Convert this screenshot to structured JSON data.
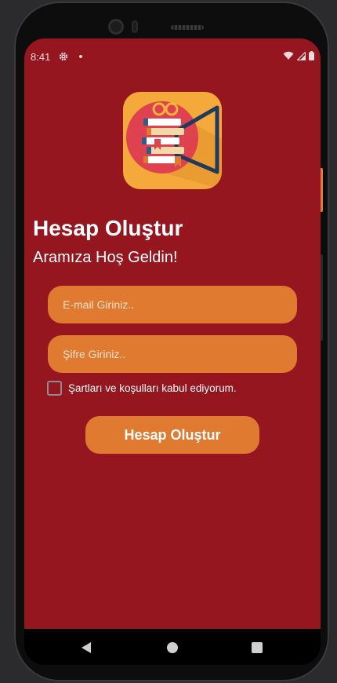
{
  "status_bar": {
    "time": "8:41",
    "icons": [
      "gear-icon",
      "dot-icon",
      "wifi-icon",
      "signal-icon",
      "battery-icon"
    ]
  },
  "logo": {
    "icon": "library-megaphone-icon",
    "colors": {
      "background": "#f6a93b",
      "circle": "#e0414f"
    }
  },
  "header": {
    "title": "Hesap Oluştur",
    "subtitle": "Aramıza Hoş Geldin!"
  },
  "form": {
    "email_placeholder": "E-mail Giriniz..",
    "password_placeholder": "Şifre Giriniz..",
    "email_value": "",
    "password_value": "",
    "terms_label": "Şartları ve koşulları kabul ediyorum.",
    "terms_checked": false,
    "submit_label": "Hesap Oluştur"
  },
  "nav_bar": {
    "icons": [
      "back-icon",
      "home-icon",
      "recent-apps-icon"
    ]
  },
  "colors": {
    "screen_background": "#961620",
    "accent": "#e07a30",
    "text": "#ffffff"
  }
}
